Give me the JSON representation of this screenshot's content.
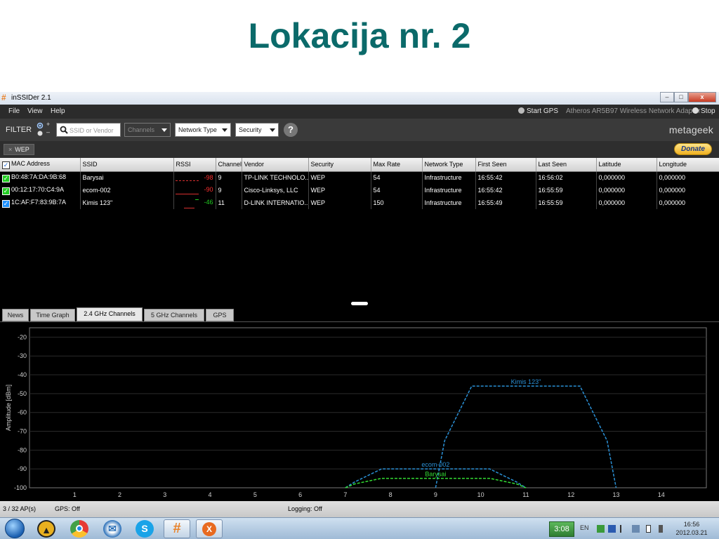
{
  "slide": {
    "title": "Lokacija nr. 2"
  },
  "window": {
    "title": "inSSIDer 2.1",
    "minimize": "–",
    "maximize": "□",
    "close": "x"
  },
  "menu": {
    "file": "File",
    "view": "View",
    "help": "Help",
    "start_gps": "Start GPS",
    "adapter": "Atheros AR5B97 Wireless Network Adapter",
    "stop": "Stop"
  },
  "filter": {
    "label": "FILTER",
    "toggle_plus": "+",
    "toggle_minus": "–",
    "search_placeholder": "SSID or Vendor",
    "channels": "Channels",
    "network_type": "Network Type",
    "security": "Security",
    "help": "?",
    "brand": "metageek"
  },
  "tagbar": {
    "chip": "WEP",
    "chip_x": "×",
    "donate": "Donate"
  },
  "table": {
    "columns": [
      "MAC Address",
      "SSID",
      "RSSI",
      "Channel",
      "Vendor",
      "Security",
      "Max Rate",
      "Network Type",
      "First Seen",
      "Last Seen",
      "Latitude",
      "Longitude"
    ],
    "rows": [
      {
        "mac": "B0:48:7A:DA:9B:68",
        "ssid": "Barysai",
        "rssi": "-98",
        "channel": "9",
        "vendor": "TP-LINK TECHNOLO...",
        "security": "WEP",
        "max_rate": "54",
        "network_type": "Infrastructure",
        "first_seen": "16:55:42",
        "last_seen": "16:56:02",
        "latitude": "0,000000",
        "longitude": "0,000000",
        "color": "#22cc22"
      },
      {
        "mac": "00:12:17:70:C4:9A",
        "ssid": "ecom-002",
        "rssi": "-90",
        "channel": "9",
        "vendor": "Cisco-Linksys, LLC",
        "security": "WEP",
        "max_rate": "54",
        "network_type": "Infrastructure",
        "first_seen": "16:55:42",
        "last_seen": "16:55:59",
        "latitude": "0,000000",
        "longitude": "0,000000",
        "color": "#22cc22"
      },
      {
        "mac": "1C:AF:F7:83:9B:7A",
        "ssid": "Kimis 123\"",
        "rssi": "-46",
        "channel": "11",
        "vendor": "D-LINK INTERNATIO...",
        "security": "WEP",
        "max_rate": "150",
        "network_type": "Infrastructure",
        "first_seen": "16:55:49",
        "last_seen": "16:55:59",
        "latitude": "0,000000",
        "longitude": "0,000000",
        "color": "#1e90ff"
      }
    ]
  },
  "tabs": [
    "News",
    "Time Graph",
    "2.4 GHz Channels",
    "5 GHz Channels",
    "GPS"
  ],
  "chart_data": {
    "type": "line",
    "title": "",
    "xlabel": "",
    "ylabel": "Amplitude [dBm]",
    "xlim": [
      0,
      15
    ],
    "ylim": [
      -100,
      -15
    ],
    "xticks": [
      1,
      2,
      3,
      4,
      5,
      6,
      7,
      8,
      9,
      10,
      11,
      12,
      13,
      14
    ],
    "yticks": [
      -20,
      -30,
      -40,
      -50,
      -60,
      -70,
      -80,
      -90,
      -100
    ],
    "grid": true,
    "series": [
      {
        "name": "Kimis 123\"",
        "color": "#2a8fd4",
        "x": [
          9,
          9.2,
          9.8,
          12.2,
          12.8,
          13
        ],
        "y": [
          -100,
          -75,
          -46,
          -46,
          -75,
          -100
        ]
      },
      {
        "name": "ecom-002",
        "color": "#2a8fd4",
        "x": [
          7,
          7.2,
          7.8,
          10.2,
          10.8,
          11
        ],
        "y": [
          -100,
          -97,
          -90,
          -90,
          -97,
          -100
        ]
      },
      {
        "name": "Barysai",
        "color": "#33dd33",
        "x": [
          7,
          7.2,
          7.8,
          10.2,
          10.8,
          11
        ],
        "y": [
          -100,
          -98,
          -95,
          -95,
          -98,
          -100
        ]
      }
    ]
  },
  "status": {
    "aps": "3 / 32 AP(s)",
    "gps": "GPS: Off",
    "logging": "Logging: Off"
  },
  "taskbar": {
    "badge": "3:08",
    "lang": "EN",
    "time": "16:56",
    "date": "2012.03.21"
  }
}
